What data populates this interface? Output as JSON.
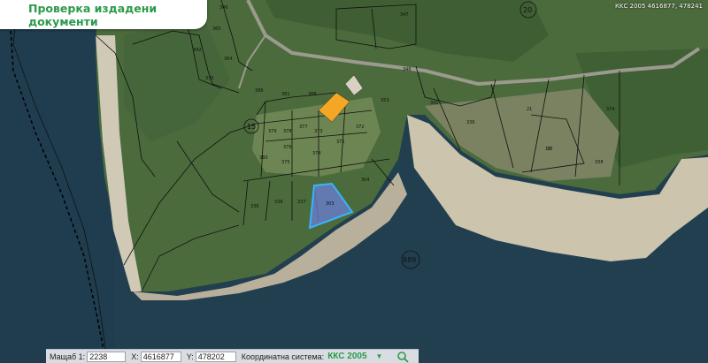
{
  "panel": {
    "title": "Проверка издадени документи"
  },
  "coord_readout": "КKС 2005 4616877, 478241",
  "map": {
    "parcel_numbers": [
      "347",
      "365",
      "364",
      "342",
      "346",
      "370",
      "386",
      "381",
      "388",
      "379",
      "378",
      "377",
      "373",
      "372",
      "376",
      "375",
      "374",
      "371",
      "380",
      "304",
      "336",
      "338",
      "303",
      "337",
      "353",
      "341",
      "336",
      "346",
      "21",
      "18",
      "16",
      "374",
      "338"
    ],
    "circle_labels": [
      "20",
      "15",
      "889"
    ],
    "selected_parcel": "303",
    "colors": {
      "water": "#1e3c4e",
      "land": "#4a6a3a",
      "shore": "#c9c3b0",
      "selected_fill": "#6a7fd6",
      "selected_stroke": "#35b6ff",
      "building": "#f5a623"
    }
  },
  "status_bar": {
    "scale_label": "Мащаб 1:",
    "scale_value": "2238",
    "x_label": "X:",
    "x_value": "4616877",
    "y_label": "Y:",
    "y_value": "478202",
    "system_label": "Координатна система:",
    "system_value": "ККС 2005",
    "dropdown_icon": "triangle-down-icon",
    "search_icon": "search-icon"
  }
}
